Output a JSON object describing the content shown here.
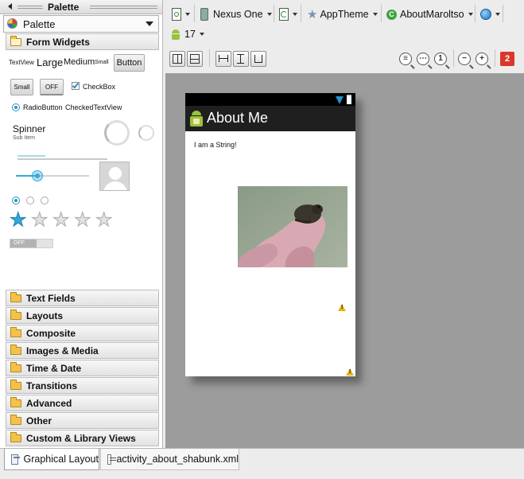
{
  "palette": {
    "panel_title": "Palette",
    "dropdown_label": "Palette",
    "open_category": "Form Widgets",
    "categories": [
      "Text Fields",
      "Layouts",
      "Composite",
      "Images & Media",
      "Time & Date",
      "Transitions",
      "Advanced",
      "Other",
      "Custom & Library Views"
    ],
    "widgets": {
      "textview": "TextView",
      "large": "Large",
      "medium": "Medium",
      "small": "Small",
      "button": "Button",
      "small_button": "Small",
      "toggle_off": "OFF",
      "checkbox": "CheckBox",
      "radiobutton": "RadioButton",
      "checked_textview": "CheckedTextView",
      "spinner": "Spinner",
      "sub_item": "Sub Item",
      "switch_off": "OFF"
    },
    "rating_stars": {
      "filled": 1,
      "total": 5
    }
  },
  "toolbar": {
    "device": "Nexus One",
    "theme": "AppTheme",
    "activity": "AboutMaroltso",
    "api_level": "17",
    "error_count": "2"
  },
  "device_preview": {
    "app_title": "About Me",
    "body_text": "I am a String!"
  },
  "tabs": {
    "graphical": "Graphical Layout",
    "xml": "activity_about_shabunk.xml"
  }
}
